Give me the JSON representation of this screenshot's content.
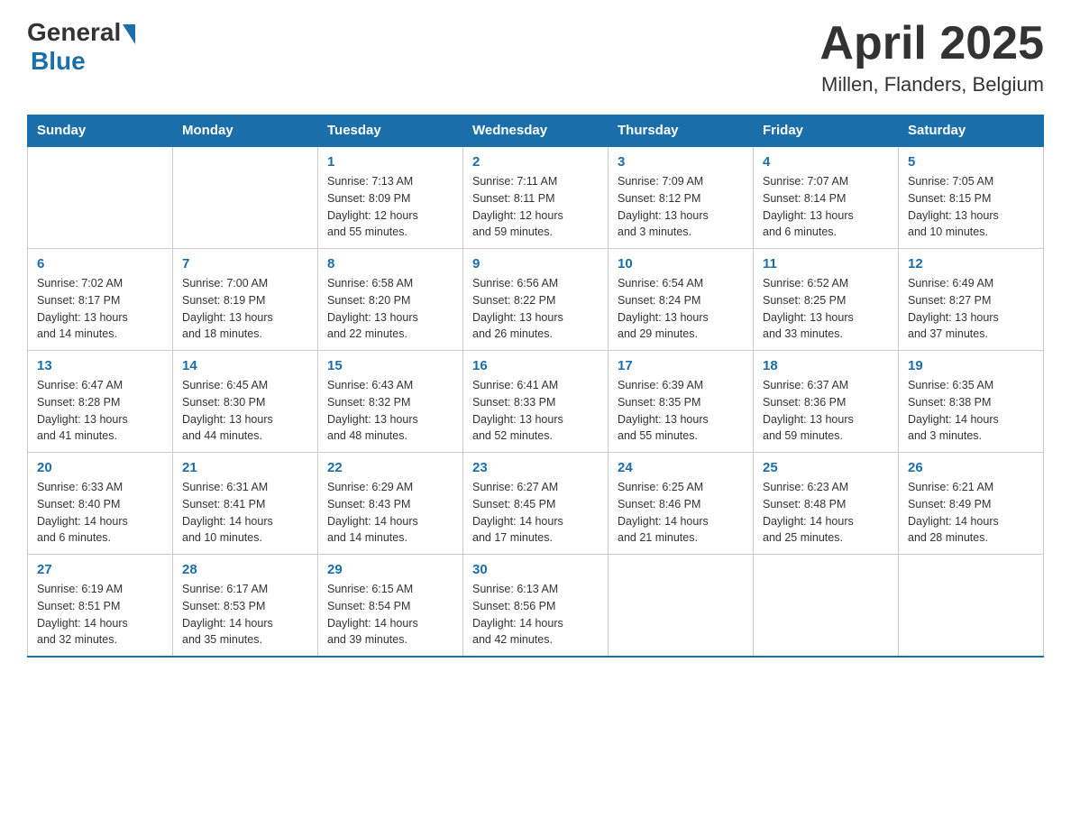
{
  "header": {
    "logo_general": "General",
    "logo_blue": "Blue",
    "title": "April 2025",
    "location": "Millen, Flanders, Belgium"
  },
  "days_of_week": [
    "Sunday",
    "Monday",
    "Tuesday",
    "Wednesday",
    "Thursday",
    "Friday",
    "Saturday"
  ],
  "weeks": [
    [
      {
        "day": "",
        "info": ""
      },
      {
        "day": "",
        "info": ""
      },
      {
        "day": "1",
        "info": "Sunrise: 7:13 AM\nSunset: 8:09 PM\nDaylight: 12 hours\nand 55 minutes."
      },
      {
        "day": "2",
        "info": "Sunrise: 7:11 AM\nSunset: 8:11 PM\nDaylight: 12 hours\nand 59 minutes."
      },
      {
        "day": "3",
        "info": "Sunrise: 7:09 AM\nSunset: 8:12 PM\nDaylight: 13 hours\nand 3 minutes."
      },
      {
        "day": "4",
        "info": "Sunrise: 7:07 AM\nSunset: 8:14 PM\nDaylight: 13 hours\nand 6 minutes."
      },
      {
        "day": "5",
        "info": "Sunrise: 7:05 AM\nSunset: 8:15 PM\nDaylight: 13 hours\nand 10 minutes."
      }
    ],
    [
      {
        "day": "6",
        "info": "Sunrise: 7:02 AM\nSunset: 8:17 PM\nDaylight: 13 hours\nand 14 minutes."
      },
      {
        "day": "7",
        "info": "Sunrise: 7:00 AM\nSunset: 8:19 PM\nDaylight: 13 hours\nand 18 minutes."
      },
      {
        "day": "8",
        "info": "Sunrise: 6:58 AM\nSunset: 8:20 PM\nDaylight: 13 hours\nand 22 minutes."
      },
      {
        "day": "9",
        "info": "Sunrise: 6:56 AM\nSunset: 8:22 PM\nDaylight: 13 hours\nand 26 minutes."
      },
      {
        "day": "10",
        "info": "Sunrise: 6:54 AM\nSunset: 8:24 PM\nDaylight: 13 hours\nand 29 minutes."
      },
      {
        "day": "11",
        "info": "Sunrise: 6:52 AM\nSunset: 8:25 PM\nDaylight: 13 hours\nand 33 minutes."
      },
      {
        "day": "12",
        "info": "Sunrise: 6:49 AM\nSunset: 8:27 PM\nDaylight: 13 hours\nand 37 minutes."
      }
    ],
    [
      {
        "day": "13",
        "info": "Sunrise: 6:47 AM\nSunset: 8:28 PM\nDaylight: 13 hours\nand 41 minutes."
      },
      {
        "day": "14",
        "info": "Sunrise: 6:45 AM\nSunset: 8:30 PM\nDaylight: 13 hours\nand 44 minutes."
      },
      {
        "day": "15",
        "info": "Sunrise: 6:43 AM\nSunset: 8:32 PM\nDaylight: 13 hours\nand 48 minutes."
      },
      {
        "day": "16",
        "info": "Sunrise: 6:41 AM\nSunset: 8:33 PM\nDaylight: 13 hours\nand 52 minutes."
      },
      {
        "day": "17",
        "info": "Sunrise: 6:39 AM\nSunset: 8:35 PM\nDaylight: 13 hours\nand 55 minutes."
      },
      {
        "day": "18",
        "info": "Sunrise: 6:37 AM\nSunset: 8:36 PM\nDaylight: 13 hours\nand 59 minutes."
      },
      {
        "day": "19",
        "info": "Sunrise: 6:35 AM\nSunset: 8:38 PM\nDaylight: 14 hours\nand 3 minutes."
      }
    ],
    [
      {
        "day": "20",
        "info": "Sunrise: 6:33 AM\nSunset: 8:40 PM\nDaylight: 14 hours\nand 6 minutes."
      },
      {
        "day": "21",
        "info": "Sunrise: 6:31 AM\nSunset: 8:41 PM\nDaylight: 14 hours\nand 10 minutes."
      },
      {
        "day": "22",
        "info": "Sunrise: 6:29 AM\nSunset: 8:43 PM\nDaylight: 14 hours\nand 14 minutes."
      },
      {
        "day": "23",
        "info": "Sunrise: 6:27 AM\nSunset: 8:45 PM\nDaylight: 14 hours\nand 17 minutes."
      },
      {
        "day": "24",
        "info": "Sunrise: 6:25 AM\nSunset: 8:46 PM\nDaylight: 14 hours\nand 21 minutes."
      },
      {
        "day": "25",
        "info": "Sunrise: 6:23 AM\nSunset: 8:48 PM\nDaylight: 14 hours\nand 25 minutes."
      },
      {
        "day": "26",
        "info": "Sunrise: 6:21 AM\nSunset: 8:49 PM\nDaylight: 14 hours\nand 28 minutes."
      }
    ],
    [
      {
        "day": "27",
        "info": "Sunrise: 6:19 AM\nSunset: 8:51 PM\nDaylight: 14 hours\nand 32 minutes."
      },
      {
        "day": "28",
        "info": "Sunrise: 6:17 AM\nSunset: 8:53 PM\nDaylight: 14 hours\nand 35 minutes."
      },
      {
        "day": "29",
        "info": "Sunrise: 6:15 AM\nSunset: 8:54 PM\nDaylight: 14 hours\nand 39 minutes."
      },
      {
        "day": "30",
        "info": "Sunrise: 6:13 AM\nSunset: 8:56 PM\nDaylight: 14 hours\nand 42 minutes."
      },
      {
        "day": "",
        "info": ""
      },
      {
        "day": "",
        "info": ""
      },
      {
        "day": "",
        "info": ""
      }
    ]
  ]
}
